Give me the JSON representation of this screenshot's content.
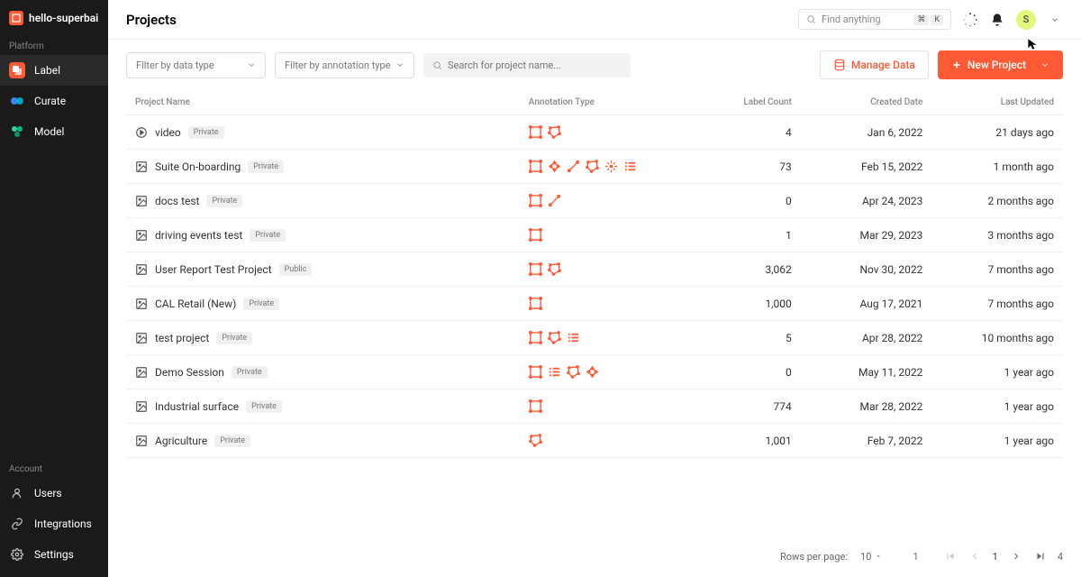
{
  "workspace": "hello-superbai",
  "page_title": "Projects",
  "global_search_placeholder": "Find anything",
  "global_search_kbd": [
    "⌘",
    "K"
  ],
  "avatar_initial": "S",
  "sidebar": {
    "platform_label": "Platform",
    "account_label": "Account",
    "items": [
      {
        "label": "Label"
      },
      {
        "label": "Curate"
      },
      {
        "label": "Model"
      }
    ],
    "account_items": [
      {
        "label": "Users"
      },
      {
        "label": "Integrations"
      },
      {
        "label": "Settings"
      }
    ]
  },
  "filters": {
    "data_type": "Filter by data type",
    "annotation_type": "Filter by annotation type",
    "search_placeholder": "Search for project name..."
  },
  "buttons": {
    "manage_data": "Manage Data",
    "new_project": "New Project"
  },
  "columns": {
    "name": "Project Name",
    "anno": "Annotation Type",
    "count": "Label Count",
    "created": "Created Date",
    "updated": "Last Updated"
  },
  "rows": [
    {
      "type": "video",
      "name": "video",
      "badge": "Private",
      "anno": [
        "box",
        "poly"
      ],
      "count": "4",
      "created": "Jan 6, 2022",
      "updated": "21 days ago"
    },
    {
      "type": "image",
      "name": "Suite On-boarding",
      "badge": "Private",
      "anno": [
        "box",
        "rotate",
        "line",
        "poly",
        "keypoint",
        "list"
      ],
      "count": "73",
      "created": "Feb 15, 2022",
      "updated": "1 month ago"
    },
    {
      "type": "image",
      "name": "docs test",
      "badge": "Private",
      "anno": [
        "box",
        "line"
      ],
      "count": "0",
      "created": "Apr 24, 2023",
      "updated": "2 months ago"
    },
    {
      "type": "image",
      "name": "driving events test",
      "badge": "Private",
      "anno": [
        "box"
      ],
      "count": "1",
      "created": "Mar 29, 2023",
      "updated": "3 months ago"
    },
    {
      "type": "image",
      "name": "User Report Test Project",
      "badge": "Public",
      "anno": [
        "box",
        "poly"
      ],
      "count": "3,062",
      "created": "Nov 30, 2022",
      "updated": "7 months ago"
    },
    {
      "type": "image",
      "name": "CAL Retail (New)",
      "badge": "Private",
      "anno": [
        "box"
      ],
      "count": "1,000",
      "created": "Aug 17, 2021",
      "updated": "7 months ago"
    },
    {
      "type": "image",
      "name": "test project",
      "badge": "Private",
      "anno": [
        "box",
        "poly",
        "list"
      ],
      "count": "5",
      "created": "Apr 28, 2022",
      "updated": "10 months ago"
    },
    {
      "type": "image",
      "name": "Demo Session",
      "badge": "Private",
      "anno": [
        "box",
        "list",
        "poly",
        "rotate"
      ],
      "count": "0",
      "created": "May 11, 2022",
      "updated": "1 year ago"
    },
    {
      "type": "image",
      "name": "Industrial surface",
      "badge": "Private",
      "anno": [
        "box"
      ],
      "count": "774",
      "created": "Mar 28, 2022",
      "updated": "1 year ago"
    },
    {
      "type": "image",
      "name": "Agriculture",
      "badge": "Private",
      "anno": [
        "poly"
      ],
      "count": "1,001",
      "created": "Feb 7, 2022",
      "updated": "1 year ago"
    }
  ],
  "pagination": {
    "rows_per_page_label": "Rows per page:",
    "rows_per_page": "10",
    "page_input": "1",
    "current_page": "1",
    "total_pages": "4"
  }
}
